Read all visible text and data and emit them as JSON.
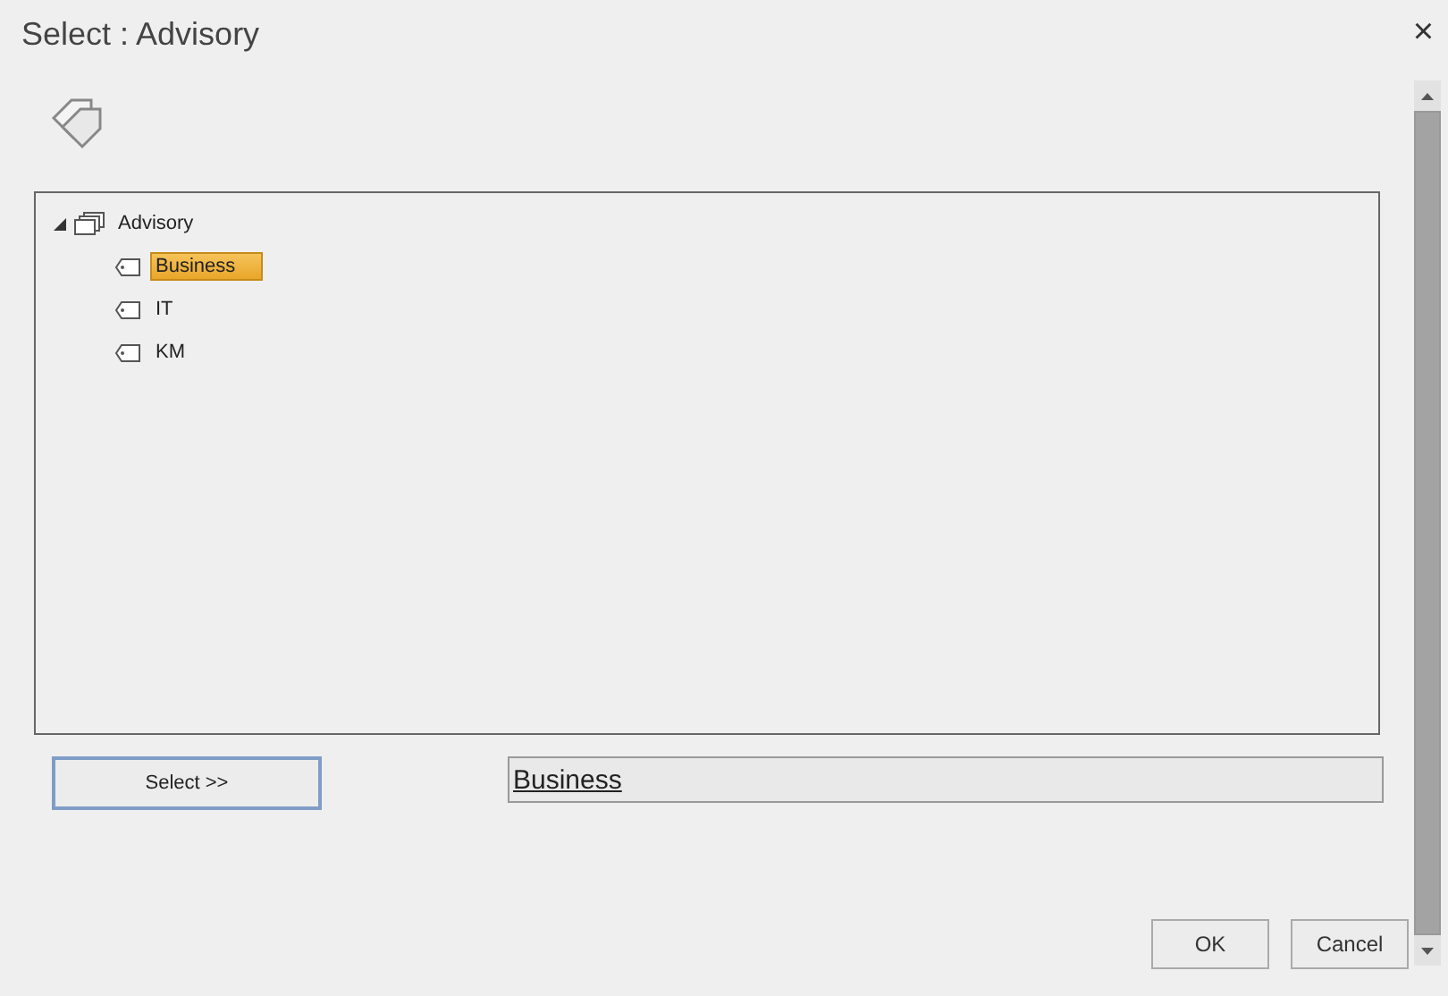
{
  "window": {
    "title": "Select : Advisory",
    "close": "×"
  },
  "tree": [
    {
      "label": "Advisory",
      "kind": "folder",
      "expanded": true,
      "selected": false,
      "children": [
        {
          "label": "Business",
          "kind": "tag",
          "selected": true
        },
        {
          "label": "IT",
          "kind": "tag",
          "selected": false
        },
        {
          "label": "KM",
          "kind": "tag",
          "selected": false
        }
      ]
    }
  ],
  "select_button": "Select >>",
  "selection_field": {
    "value": "Business"
  },
  "buttons": [
    "OK",
    "Cancel"
  ]
}
